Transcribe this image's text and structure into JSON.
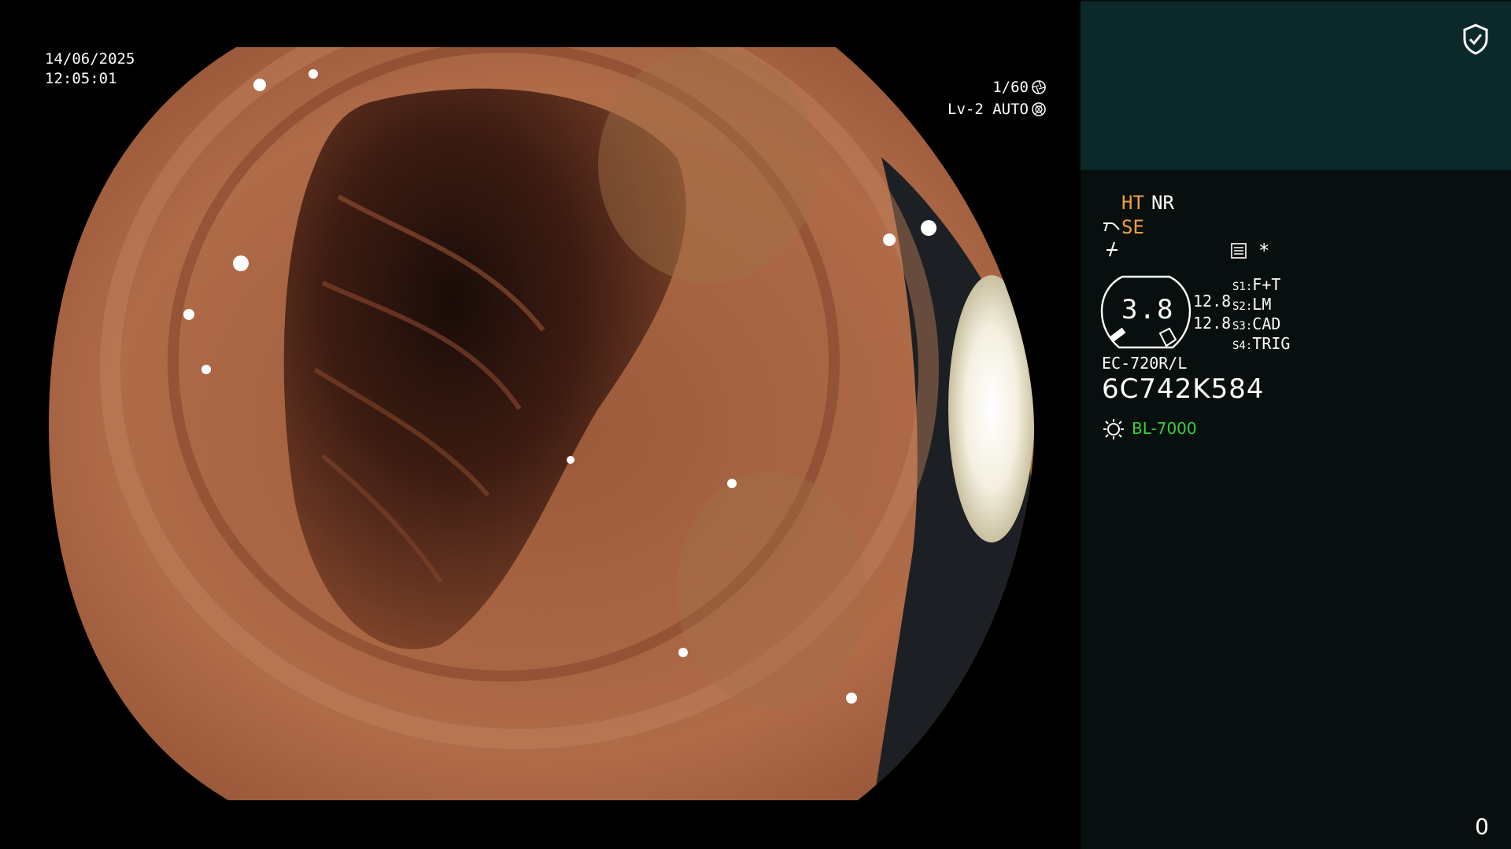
{
  "view": {
    "date": "14/06/2025",
    "time": "12:05:01",
    "shutter": "1/60",
    "level": "Lv-2 AUTO",
    "icons": [
      "shutter-icon",
      "iris-icon"
    ]
  },
  "panel": {
    "shield_icon": "shield-check-icon",
    "ht": "HT",
    "nr": "NR",
    "se": "SE",
    "asterisk": "*",
    "gauge_value": "3.8",
    "num_a": "12.8",
    "num_b": "12.8",
    "switches": [
      {
        "key": "S1:",
        "value": "F+T"
      },
      {
        "key": "S2:",
        "value": "LM"
      },
      {
        "key": "S3:",
        "value": "CAD"
      },
      {
        "key": "S4:",
        "value": "TRIG"
      }
    ],
    "model": "EC-720R/L",
    "serial": "6C742K584",
    "lamp": "BL-7000",
    "counter": "0"
  },
  "colors": {
    "amber": "#f0a040",
    "green": "#39d139",
    "panel_header": "#0c2929",
    "panel_body": "#080f0f"
  }
}
